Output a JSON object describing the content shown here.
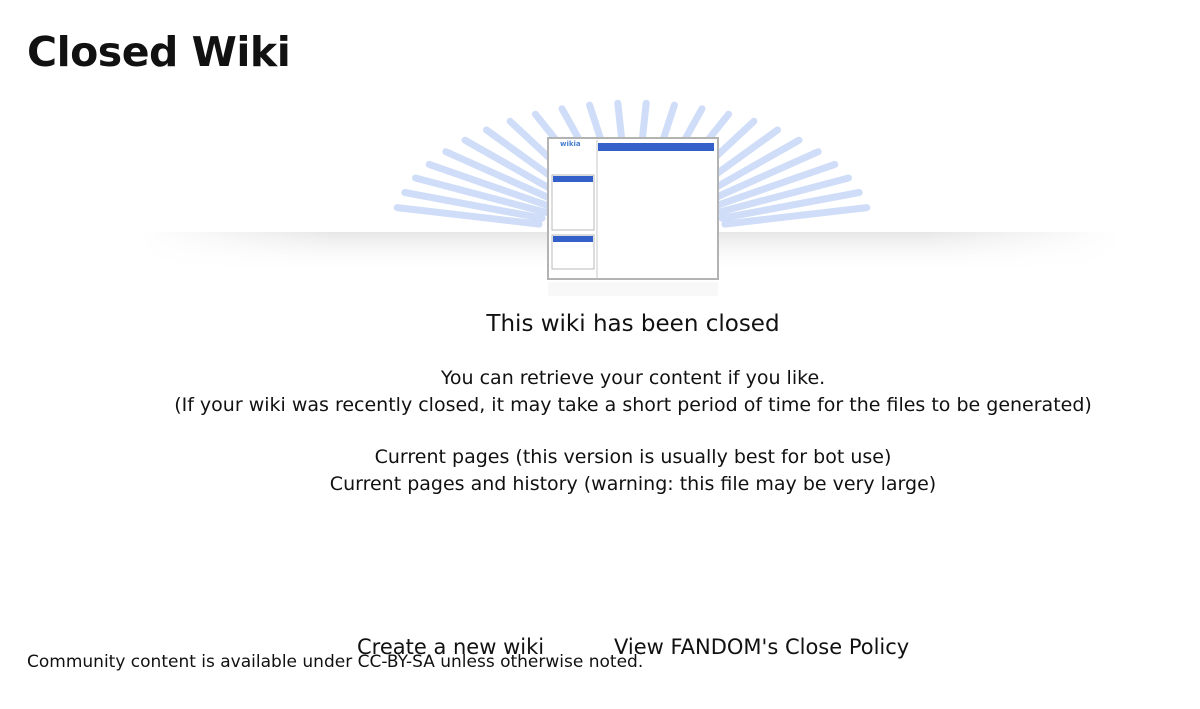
{
  "page": {
    "title": "Closed Wiki"
  },
  "hero": {
    "logo_text": "wikia",
    "accent_color": "#3461c9",
    "ray_color": "#c7d8f7"
  },
  "main": {
    "heading": "This wiki has been closed",
    "retrieve_text": "You can retrieve your content if you like.",
    "note_text": "(If your wiki was recently closed, it may take a short period of time for the files to be generated)",
    "dump_links": [
      {
        "label": "Current pages (this version is usually best for bot use)"
      },
      {
        "label": "Current pages and history (warning: this file may be very large)"
      }
    ]
  },
  "footer": {
    "create_label": "Create a new wiki",
    "policy_label": "View FANDOM's Close Policy",
    "license_text": "Community content is available under CC-BY-SA unless otherwise noted."
  }
}
